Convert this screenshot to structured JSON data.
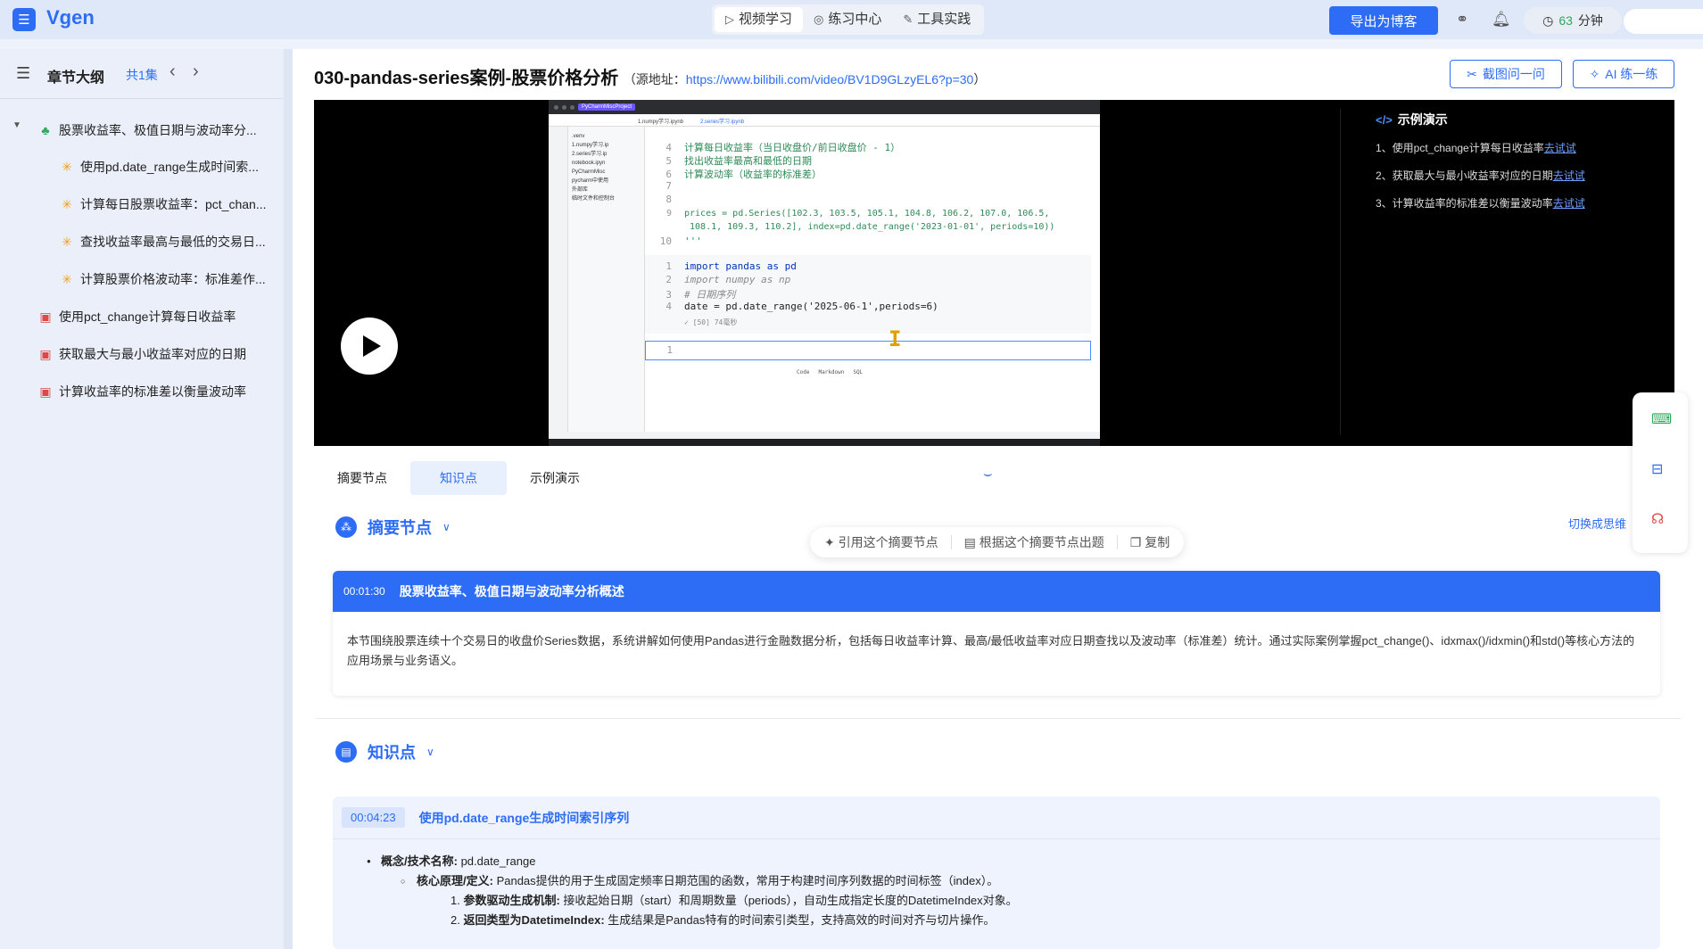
{
  "app": {
    "logo_icon": "list-icon",
    "name": "Vgen"
  },
  "nav": {
    "tabs": [
      {
        "label": "视频学习",
        "icon": "play-icon",
        "active": true
      },
      {
        "label": "练习中心",
        "icon": "target-icon",
        "active": false
      },
      {
        "label": "工具实践",
        "icon": "wrench-icon",
        "active": false
      }
    ],
    "export_label": "导出为博客",
    "timer_value": "63",
    "timer_unit": "分钟"
  },
  "sidebar": {
    "title": "章节大纲",
    "count": "共1集",
    "items": [
      {
        "label": "股票收益率、极值日期与波动率分..."
      },
      {
        "label": "使用pd.date_range生成时间索..."
      },
      {
        "label": "计算每日股票收益率：pct_chan..."
      },
      {
        "label": "查找收益率最高与最低的交易日..."
      },
      {
        "label": "计算股票价格波动率：标准差作..."
      },
      {
        "label": "使用pct_change计算每日收益率"
      },
      {
        "label": "获取最大与最小收益率对应的日期"
      },
      {
        "label": "计算收益率的标准差以衡量波动率"
      }
    ]
  },
  "page": {
    "title": "030-pandas-series案例-股票价格分析",
    "source_prefix": "（源地址：",
    "source_url": "https://www.bilibili.com/video/BV1D9GLzyEL6?p=30",
    "source_suffix": "）",
    "screenshot_ask": "截图问一问",
    "ai_practice": "AI 练一练"
  },
  "video": {
    "ide": {
      "project": "PyCharmMiscProject",
      "tabs": [
        "1.numpy学习.ipynb",
        "2.series学习.ipynb"
      ],
      "tree": [
        ".venv",
        "1.numpy学习.ip",
        "2.series学习.ip",
        "notebook.ipyn",
        "PyCharmMisc",
        "pycharm中使用",
        "外部库",
        "临时文件和控制台"
      ],
      "code_top": [
        {
          "n": "4",
          "t": "计算每日收益率（当日收盘价/前日收盘价 - 1）"
        },
        {
          "n": "5",
          "t": "找出收益率最高和最低的日期"
        },
        {
          "n": "6",
          "t": "计算波动率（收益率的标准差）"
        },
        {
          "n": "7",
          "t": ""
        },
        {
          "n": "8",
          "t": ""
        },
        {
          "n": "9",
          "t": "prices = pd.Series([102.3, 103.5, 105.1, 104.8, 106.2, 107.0, 106.5,"
        },
        {
          "n": "",
          "t": " 108.1, 109.3, 110.2], index=pd.date_range('2023-01-01', periods=10))"
        },
        {
          "n": "10",
          "t": "'''"
        }
      ],
      "code_cell": [
        {
          "n": "1",
          "t": "import pandas as pd"
        },
        {
          "n": "2",
          "t": "import numpy as np"
        },
        {
          "n": "3",
          "t": "# 日期序列"
        },
        {
          "n": "4",
          "t": "date = pd.date_range('2025-06-1',periods=6)"
        }
      ],
      "cell_status": "✓ [50] 74毫秒",
      "empty_cell_line": "1",
      "add_cell": [
        "Code",
        "Markdown",
        "SQL"
      ]
    },
    "demo": {
      "title": "示例演示",
      "items": [
        {
          "text": "1、使用pct_change计算每日收益率",
          "link": "去试试"
        },
        {
          "text": "2、获取最大与最小收益率对应的日期",
          "link": "去试试"
        },
        {
          "text": "3、计算收益率的标准差以衡量波动率",
          "link": "去试试"
        }
      ]
    }
  },
  "content_tabs": [
    {
      "label": "摘要节点",
      "active": false
    },
    {
      "label": "知识点",
      "active": true
    },
    {
      "label": "示例演示",
      "active": false
    }
  ],
  "summary": {
    "section_title": "摘要节点",
    "switch_label": "切换成思维",
    "tools": [
      "引用这个摘要节点",
      "根据这个摘要节点出题",
      "复制"
    ],
    "timestamp": "00:01:30",
    "heading": "股票收益率、极值日期与波动率分析概述",
    "text": "本节围绕股票连续十个交易日的收盘价Series数据，系统讲解如何使用Pandas进行金融数据分析，包括每日收益率计算、最高/最低收益率对应日期查找以及波动率（标准差）统计。通过实际案例掌握pct_change()、idxmax()/idxmin()和std()等核心方法的应用场景与业务语义。"
  },
  "knowledge": {
    "section_title": "知识点",
    "timestamp": "00:04:23",
    "heading": "使用pd.date_range生成时间索引序列",
    "concept_label": "概念/技术名称:",
    "concept_value": " pd.date_range",
    "principle_label": "核心原理/定义:",
    "principle_value": " Pandas提供的用于生成固定频率日期范围的函数，常用于构建时间序列数据的时间标签（index）。",
    "points": [
      {
        "label": "参数驱动生成机制:",
        "value": " 接收起始日期（start）和周期数量（periods），自动生成指定长度的DatetimeIndex对象。"
      },
      {
        "label": "返回类型为DatetimeIndex:",
        "value": " 生成结果是Pandas特有的时间索引类型，支持高效的时间对齐与切片操作。"
      }
    ]
  },
  "colors": {
    "accent": "#2d6df6",
    "success": "#2eaa5a"
  }
}
